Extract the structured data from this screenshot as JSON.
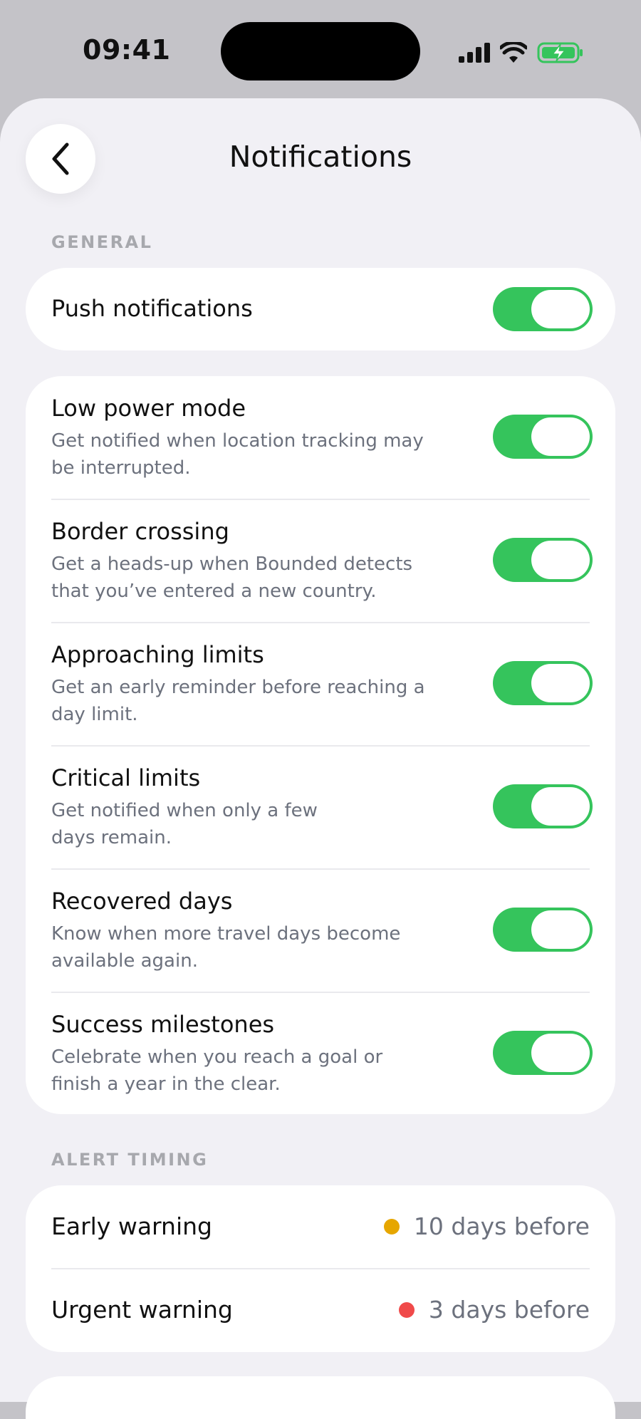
{
  "status": {
    "time": "09:41"
  },
  "header": {
    "title": "Notifications"
  },
  "colors": {
    "toggle_on": "#35c45c",
    "early_dot": "#e6a600",
    "urgent_dot": "#f04a4a"
  },
  "general": {
    "section_label": "GENERAL",
    "push": {
      "title": "Push notifications",
      "enabled": true
    }
  },
  "settings": [
    {
      "title": "Low power mode",
      "desc1": "Get notified when location tracking may",
      "desc2": "be interrupted.",
      "enabled": true
    },
    {
      "title": "Border crossing",
      "desc1": "Get a heads-up when Bounded detects",
      "desc2": "that you’ve entered a new country.",
      "enabled": true
    },
    {
      "title": "Approaching limits",
      "desc1": "Get an early reminder before reaching a",
      "desc2": "day limit.",
      "enabled": true
    },
    {
      "title": "Critical limits",
      "desc1": "Get notified when only a few",
      "desc2": "days remain.",
      "enabled": true
    },
    {
      "title": "Recovered days",
      "desc1": "Know when more travel days become",
      "desc2": "available again.",
      "enabled": true
    },
    {
      "title": "Success milestones",
      "desc1": "Celebrate when you reach a goal or",
      "desc2": "finish a year in the clear.",
      "enabled": true
    }
  ],
  "alert_timing": {
    "section_label": "ALERT TIMING",
    "early": {
      "label": "Early warning",
      "value": "10 days before"
    },
    "urgent": {
      "label": "Urgent warning",
      "value": "3 days before"
    }
  }
}
